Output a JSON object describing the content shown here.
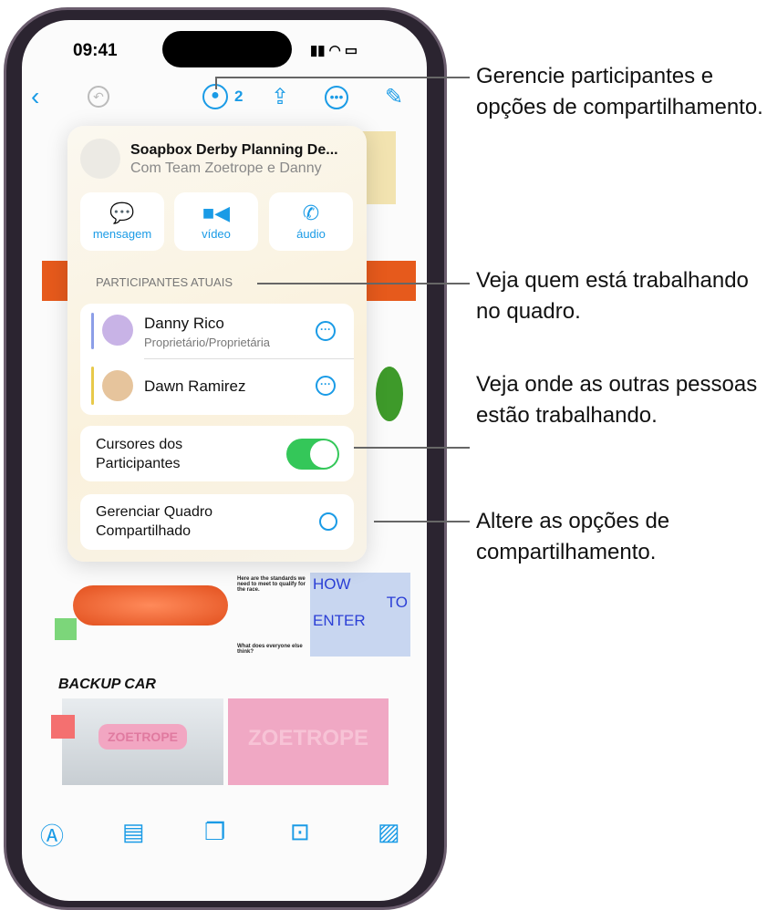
{
  "status_bar": {
    "time": "09:41"
  },
  "toolbar": {
    "participant_count": "2",
    "icons": [
      "chevron-left-icon",
      "undo-icon",
      "collaboration-icon",
      "share-icon",
      "more-icon",
      "compose-icon"
    ]
  },
  "popover": {
    "title": "Soapbox Derby Planning De...",
    "subtitle": "Com Team Zoetrope e Danny",
    "actions": [
      {
        "label": "mensagem",
        "icon": "message-icon"
      },
      {
        "label": "vídeo",
        "icon": "video-icon"
      },
      {
        "label": "áudio",
        "icon": "phone-icon"
      }
    ],
    "section_label": "PARTICIPANTES ATUAIS",
    "participants": [
      {
        "name": "Danny Rico",
        "role": "Proprietário/Proprietária",
        "color": "#8c9ee8"
      },
      {
        "name": "Dawn Ramirez",
        "role": "",
        "color": "#e8c94a"
      }
    ],
    "cursors_label": "Cursores dos Participantes",
    "cursors_on": true,
    "manage_label": "Gerenciar Quadro Compartilhado"
  },
  "board": {
    "note_heading": "Here are the standards we need to meet to qualify for the race.",
    "note_question": "What does everyone else think?",
    "how": "HOW",
    "to": "TO",
    "enter": "ENTER",
    "backup": "BACKUP CAR",
    "brand": "ZOETROPE"
  },
  "callouts": [
    "Gerencie participantes e opções de compartilhamento.",
    "Veja quem está trabalhando no quadro.",
    "Veja onde as outras pessoas estão trabalhando.",
    "Altere as opções de compartilhamento."
  ],
  "colors": {
    "accent": "#1a9be6",
    "toggle_on": "#34c759"
  }
}
